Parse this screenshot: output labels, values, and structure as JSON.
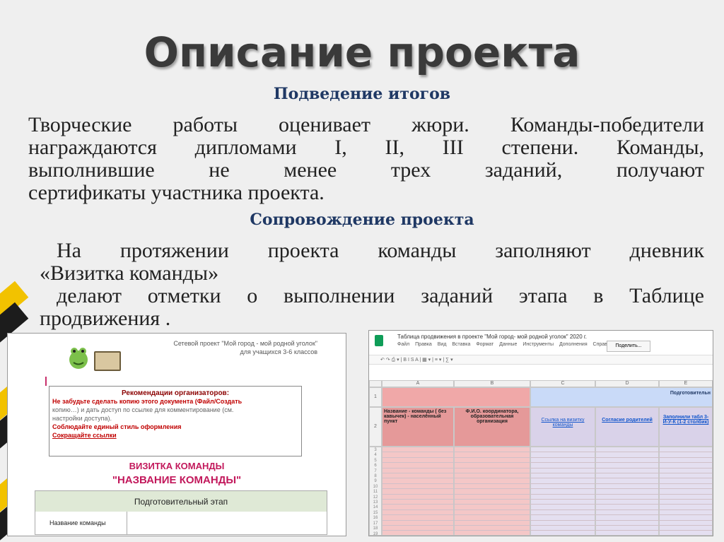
{
  "slide": {
    "title": "Описание проекта",
    "section1_heading": "Подведение итогов",
    "section1_lines": [
      "Творческие работы оценивает жюри. Команды-победители",
      "награждаются дипломами I, II, III степени. Команды,",
      "выполнившие не менее трех заданий, получают",
      "сертификаты участника проекта."
    ],
    "section2_heading": "Сопровождение проекта",
    "section2_lines": [
      "На протяжении проекта команды заполняют дневник",
      "«Визитка команды»",
      "делают отметки о выполнении заданий этапа в Таблице",
      "продвижения ."
    ]
  },
  "doc_shot": {
    "header_line1": "Сетевой проект \"Мой город - мой родной уголок\"",
    "header_line2": "для учащихся 3-6 классов",
    "rec_title": "Рекомендации организаторов:",
    "rec_line1": "Не забудьте сделать копию этого документа (Файл/Создать",
    "rec_line2": "копию…) и дать доступ по ссылке для комментирование (см.",
    "rec_line3": "настройки доступа).",
    "rec_line4": "Соблюдайте единый стиль оформления",
    "rec_line5": "Сокращайте ссылки",
    "card_title": "ВИЗИТКА КОМАНДЫ",
    "team_name": "\"НАЗВАНИЕ КОМАНДЫ\"",
    "stage": "Подготовительный этап",
    "row_label": "Название команды"
  },
  "sheet_shot": {
    "title": "Таблица продвижения в проекте \"Мой город- мой родной уголок\" 2020 г.",
    "menu": "Файл Правка Вид Вставка Формат Данные Инструменты Дополнения Справка",
    "share": "Поделить...",
    "col_a": "A",
    "col_b": "B",
    "col_c": "C",
    "col_d": "D",
    "col_e": "E",
    "stage": "Подготовительн",
    "h_a": "Название - команды ( без кавычек) - населённый пункт",
    "h_b": "Ф.И.О. координатора, образовательная организация",
    "h_c": "Ссылка на визитку команды",
    "h_d": "Согласие родителей",
    "h_e": "Заполнили табл 3-И-У-К (1-2 столбик)",
    "row1": "1",
    "row2": "2",
    "rows": [
      "3",
      "4",
      "5",
      "6",
      "7",
      "8",
      "9",
      "10",
      "11",
      "12",
      "13",
      "14",
      "15",
      "16",
      "17",
      "18",
      "19"
    ]
  },
  "colors": {
    "heading": "#1f3864",
    "pink": "#c2185b",
    "sheet_red": "#f0a8a8",
    "sheet_purple": "#d9d2e9",
    "sheet_blue": "#c9daf8"
  }
}
